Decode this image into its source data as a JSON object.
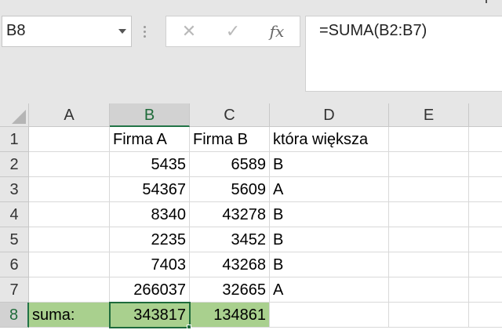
{
  "formula_bar": {
    "name_box": "B8",
    "cancel_icon": "✕",
    "enter_icon": "✓",
    "fx_label": "fx",
    "formula": "=SUMA(B2:B7)"
  },
  "columns": [
    "A",
    "B",
    "C",
    "D",
    "E"
  ],
  "rows": [
    "1",
    "2",
    "3",
    "4",
    "5",
    "6",
    "7",
    "8"
  ],
  "cells": {
    "B1": "Firma A",
    "C1": "Firma B",
    "D1": "która większa",
    "B2": "5435",
    "C2": "6589",
    "D2": "B",
    "B3": "54367",
    "C3": "5609",
    "D3": "A",
    "B4": "8340",
    "C4": "43278",
    "D4": "B",
    "B5": "2235",
    "C5": "3452",
    "D5": "B",
    "B6": "7403",
    "C6": "43268",
    "D6": "B",
    "B7": "266037",
    "C7": "32665",
    "D7": "A",
    "A8": "suma:",
    "B8": "343817",
    "C8": "134861"
  },
  "selection": {
    "active_cell": "B8",
    "active_column": "B",
    "active_row": "8"
  },
  "colors": {
    "sum_row_fill": "#a9d08e",
    "selection": "#1e6b3c"
  }
}
